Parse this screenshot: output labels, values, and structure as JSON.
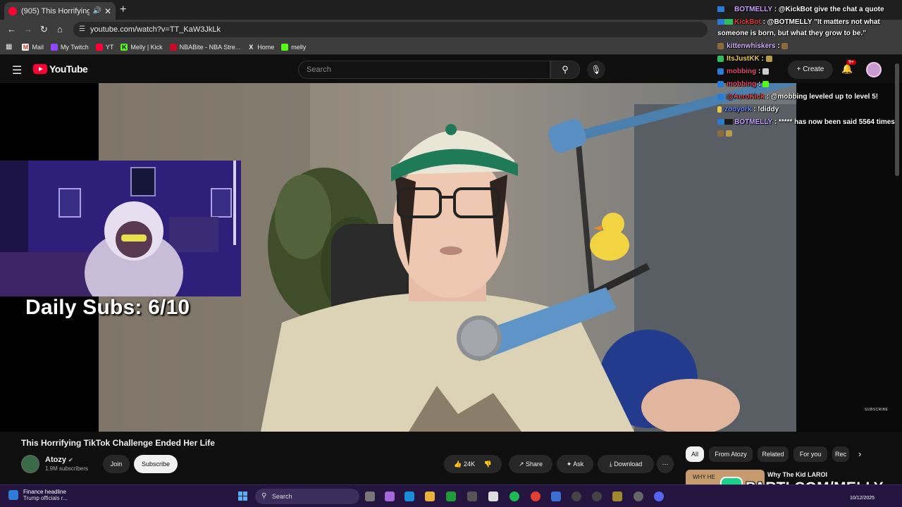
{
  "browser": {
    "tab_title": "(905) This Horrifying TikTok",
    "url": "youtube.com/watch?v=TT_KaW3JkLk",
    "bookmarks": [
      "Mail",
      "My Twitch",
      "YT",
      "Melly | Kick",
      "NBABite - NBA Stre...",
      "Home",
      "melly"
    ]
  },
  "youtube": {
    "logo_text": "YouTube",
    "search_placeholder": "Search",
    "create_label": "Create",
    "notif_badge": "9+"
  },
  "overlay": {
    "daily_subs": "Daily Subs: 6/10",
    "subscribe_watermark": "SUBSCRIBE",
    "parti_banner": "PARTI.COM/MELLY"
  },
  "video": {
    "title": "This Horrifying TikTok Challenge Ended Her Life",
    "channel": "Atozy",
    "subscribers": "1.9M subscribers",
    "join_label": "Join",
    "subscribe_label": "Subscribe",
    "likes": "24K",
    "share_label": "Share",
    "ask_label": "Ask",
    "download_label": "Download"
  },
  "chips": [
    "All",
    "From Atozy",
    "Related",
    "For you",
    "Rec"
  ],
  "recommended": {
    "title": "Why The Kid LAROI",
    "thumb_text": "WHY HE"
  },
  "chat": [
    {
      "user": "BOTMELLY",
      "color": "#c9a0ff",
      "msg": ": @KickBot give the chat a quote"
    },
    {
      "user": "KickBot",
      "color": "#e23b3b",
      "msg": ": @BOTMELLY \"It matters not what"
    },
    {
      "user": "",
      "color": "#ffffff",
      "msg": "someone is born, but what they grow to be.\""
    },
    {
      "user": "kittenwhiskers",
      "color": "#d0b0ff",
      "msg": ":"
    },
    {
      "user": "ItsJustKK",
      "color": "#e6c84a",
      "msg": ":"
    },
    {
      "user": "mobbing",
      "color": "#e04a6a",
      "msg": ":"
    },
    {
      "user": "mobbing",
      "color": "#e04a6a",
      "msg": ":"
    },
    {
      "user": "@AeroKick",
      "color": "#e24a4a",
      "msg": ": @mobbing leveled up to level 5!"
    },
    {
      "user": "zooyork",
      "color": "#6b8cff",
      "msg": ": !diddy"
    },
    {
      "user": "BOTMELLY",
      "color": "#c9a0ff",
      "msg": ": ***** has now been said 5564 times"
    }
  ],
  "taskbar": {
    "news_headline": "Finance headline",
    "news_sub": "Trump officials r...",
    "search_label": "Search",
    "date": "10/12/2025"
  }
}
